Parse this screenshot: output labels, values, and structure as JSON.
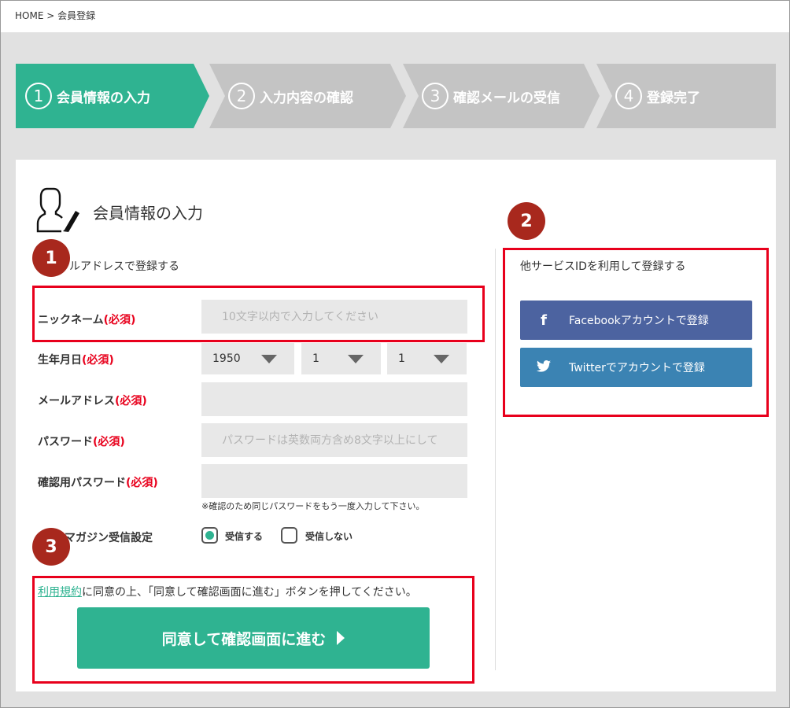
{
  "breadcrumb": {
    "home": "HOME",
    "separator": ">",
    "current": "会員登録"
  },
  "steps": [
    {
      "number": "1",
      "label": "会員情報の入力",
      "active": true
    },
    {
      "number": "2",
      "label": "入力内容の確認",
      "active": false
    },
    {
      "number": "3",
      "label": "確認メールの受信",
      "active": false
    },
    {
      "number": "4",
      "label": "登録完了",
      "active": false
    }
  ],
  "colors": {
    "accent": "#2fb391",
    "inactive_step": "#c4c4c4",
    "badge": "#a8281d",
    "highlight_box": "#e8001c",
    "facebook": "#4c63a0",
    "twitter": "#3b83b3"
  },
  "page_title": "会員情報の入力",
  "annotations": {
    "badge1": "1",
    "badge2": "2",
    "badge3": "3"
  },
  "form": {
    "section_title": "ルアドレスで登録する",
    "required_mark": "(必須)",
    "nickname": {
      "label": "ニックネーム",
      "placeholder": "10文字以内で入力してください",
      "value": ""
    },
    "birthdate": {
      "label": "生年月日",
      "year": "1950",
      "month": "1",
      "day": "1"
    },
    "email": {
      "label": "メールアドレス",
      "placeholder": "",
      "value": ""
    },
    "password": {
      "label": "パスワード",
      "placeholder": "パスワードは英数両方含め8文字以上にして",
      "value": ""
    },
    "password_confirm": {
      "label": "確認用パスワード",
      "placeholder": "",
      "value": ""
    },
    "password_hint": "※確認のため同じパスワードをもう一度入力して下さい。",
    "magazine": {
      "label": "ルマガジン受信設定",
      "option_yes": "受信する",
      "option_no": "受信しない",
      "selected": "受信する"
    },
    "terms_link": "利用規約",
    "agree_text": "に同意の上、「同意して確認画面に進む」ボタンを押してください。",
    "submit_label": "同意して確認画面に進む"
  },
  "social": {
    "title": "他サービスIDを利用して登録する",
    "facebook": {
      "icon": "facebook-icon",
      "label": "Facebookアカウントで登録"
    },
    "twitter": {
      "icon": "twitter-icon",
      "label": "Twitterでアカウントで登録"
    }
  }
}
